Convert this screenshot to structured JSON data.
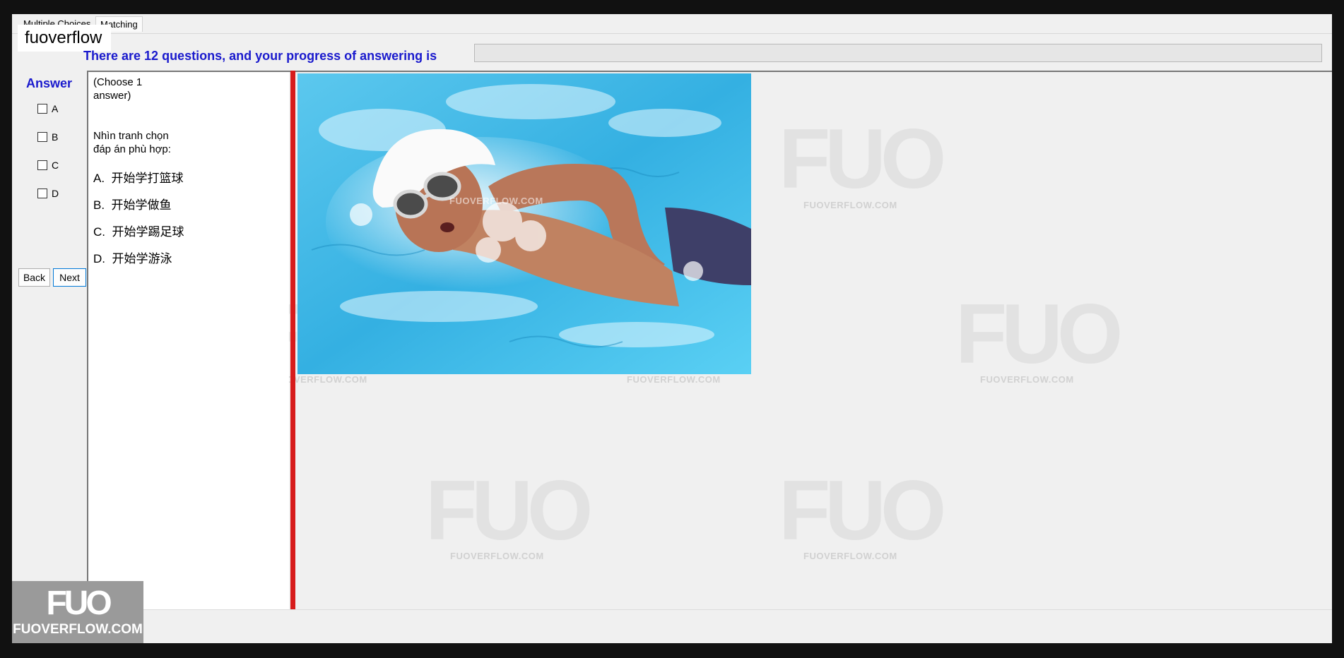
{
  "tabs": [
    {
      "label": "Multiple Choices"
    },
    {
      "label": "Matching"
    }
  ],
  "brand_label": "fuoverflow",
  "progress": {
    "text": "There are 12 questions, and your progress of answering is",
    "fraction": 0
  },
  "answer_panel": {
    "title": "Answer",
    "options": [
      "A",
      "B",
      "C",
      "D"
    ],
    "back_label": "Back",
    "next_label": "Next"
  },
  "question": {
    "instruction_line1": "(Choose 1",
    "instruction_line2": "answer)",
    "prompt_line1": "Nhìn tranh chọn",
    "prompt_line2": "đáp án phù hợp:",
    "choices": [
      {
        "letter": "A.",
        "text": "开始学打篮球"
      },
      {
        "letter": "B.",
        "text": "开始学做鱼"
      },
      {
        "letter": "C.",
        "text": "开始学踢足球"
      },
      {
        "letter": "D.",
        "text": "开始学游泳"
      }
    ]
  },
  "watermark": {
    "logo": "FUO",
    "url": "FUOVERFLOW.COM"
  },
  "photo_watermark": "FUOVERFLOW.COM",
  "corner_badge": {
    "logo": "FUO",
    "text": "FUOVERFLOW.COM"
  },
  "colors": {
    "accent_blue": "#1a1acd",
    "separator_red": "#d71c1c",
    "window_bg": "#f0f0f0",
    "outer_bg": "#111111"
  }
}
